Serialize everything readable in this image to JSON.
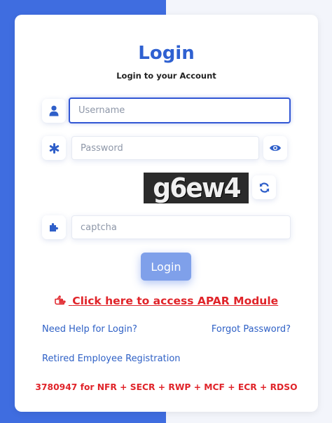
{
  "header": {
    "title": "Login",
    "subtitle": "Login to your Account"
  },
  "form": {
    "username_placeholder": "Username",
    "password_placeholder": "Password",
    "captcha_image_text": "g6ew4",
    "captcha_placeholder": "captcha",
    "login_label": "Login"
  },
  "links": {
    "apar_label": "Click here to access APAR Module",
    "help_label": "Need Help for Login?",
    "forgot_label": "Forgot Password?",
    "retired_label": "Retired Employee Registration"
  },
  "footer": {
    "helpline": "3780947 for NFR + SECR + RWP + MCF + ECR + RDSO"
  },
  "icons": [
    "user-icon",
    "asterisk-icon",
    "eye-icon",
    "refresh-icon",
    "puzzle-icon",
    "hand-pointer-icon"
  ],
  "colors": {
    "accent": "#2f61d1",
    "left_panel": "#3f6de0",
    "alert": "#e0242a",
    "button": "#7fa0ea"
  }
}
